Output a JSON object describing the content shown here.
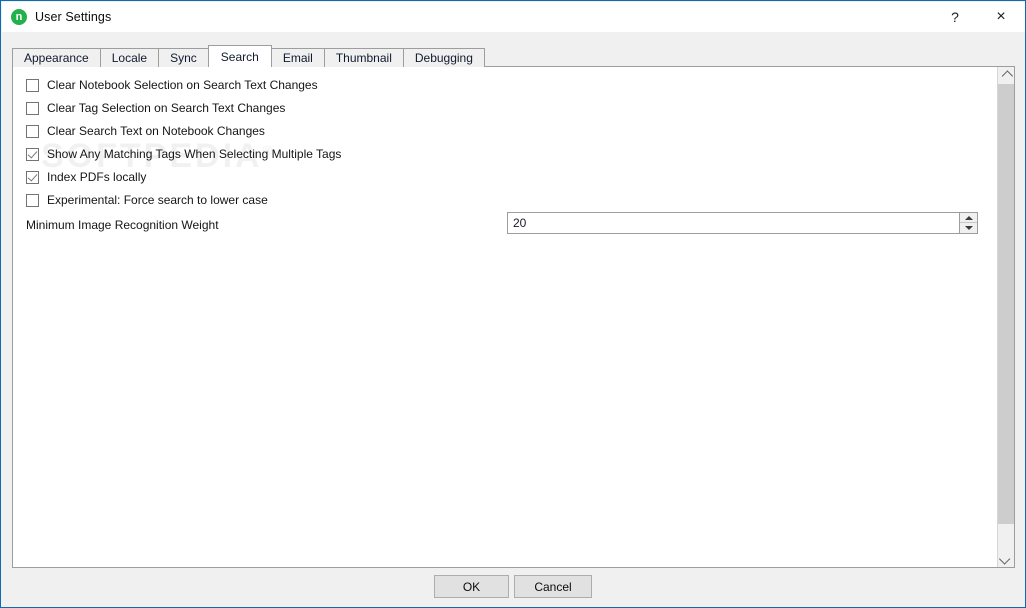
{
  "window": {
    "title": "User Settings",
    "app_icon": "notebook-n-icon",
    "accent_border": "#0b6cb3",
    "icon_color": "#22b14c",
    "help_label": "?",
    "close_label": "×"
  },
  "tabs": [
    {
      "label": "Appearance",
      "active": false
    },
    {
      "label": "Locale",
      "active": false
    },
    {
      "label": "Sync",
      "active": false
    },
    {
      "label": "Search",
      "active": true
    },
    {
      "label": "Email",
      "active": false
    },
    {
      "label": "Thumbnail",
      "active": false
    },
    {
      "label": "Debugging",
      "active": false
    }
  ],
  "watermark": {
    "text": "SOFTPEDIA",
    "mark": "®"
  },
  "settings": {
    "checkboxes": [
      {
        "label": "Clear Notebook Selection on Search Text Changes",
        "checked": false
      },
      {
        "label": "Clear Tag Selection on Search Text Changes",
        "checked": false
      },
      {
        "label": "Clear Search Text on Notebook Changes",
        "checked": false
      },
      {
        "label": "Show Any Matching Tags When Selecting Multiple Tags",
        "checked": true
      },
      {
        "label": "Index PDFs locally",
        "checked": true
      },
      {
        "label": "Experimental: Force search to lower case",
        "checked": false
      }
    ],
    "spinner": {
      "label": "Minimum Image Recognition Weight",
      "value": "20"
    }
  },
  "scrollbar": {
    "up_icon": "chevron-up-icon",
    "down_icon": "chevron-down-icon"
  },
  "footer": {
    "ok_label": "OK",
    "cancel_label": "Cancel"
  }
}
